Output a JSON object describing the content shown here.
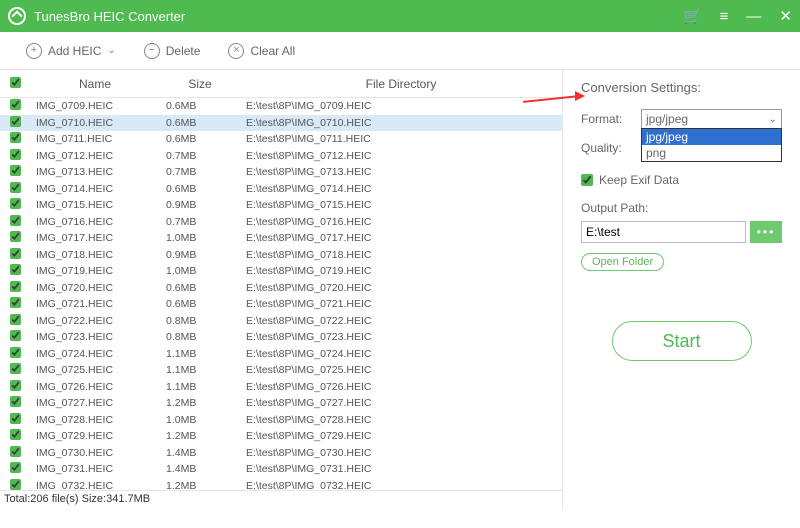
{
  "title": "TunesBro HEIC Converter",
  "toolbar": {
    "add": "Add HEIC",
    "delete": "Delete",
    "clear": "Clear All"
  },
  "columns": {
    "name": "Name",
    "size": "Size",
    "dir": "File Directory"
  },
  "files": [
    {
      "n": "IMG_0709.HEIC",
      "s": "0.6MB",
      "d": "E:\\test\\8P\\IMG_0709.HEIC",
      "sel": false
    },
    {
      "n": "IMG_0710.HEIC",
      "s": "0.6MB",
      "d": "E:\\test\\8P\\IMG_0710.HEIC",
      "sel": true
    },
    {
      "n": "IMG_0711.HEIC",
      "s": "0.6MB",
      "d": "E:\\test\\8P\\IMG_0711.HEIC",
      "sel": false
    },
    {
      "n": "IMG_0712.HEIC",
      "s": "0.7MB",
      "d": "E:\\test\\8P\\IMG_0712.HEIC",
      "sel": false
    },
    {
      "n": "IMG_0713.HEIC",
      "s": "0.7MB",
      "d": "E:\\test\\8P\\IMG_0713.HEIC",
      "sel": false
    },
    {
      "n": "IMG_0714.HEIC",
      "s": "0.6MB",
      "d": "E:\\test\\8P\\IMG_0714.HEIC",
      "sel": false
    },
    {
      "n": "IMG_0715.HEIC",
      "s": "0.9MB",
      "d": "E:\\test\\8P\\IMG_0715.HEIC",
      "sel": false
    },
    {
      "n": "IMG_0716.HEIC",
      "s": "0.7MB",
      "d": "E:\\test\\8P\\IMG_0716.HEIC",
      "sel": false
    },
    {
      "n": "IMG_0717.HEIC",
      "s": "1.0MB",
      "d": "E:\\test\\8P\\IMG_0717.HEIC",
      "sel": false
    },
    {
      "n": "IMG_0718.HEIC",
      "s": "0.9MB",
      "d": "E:\\test\\8P\\IMG_0718.HEIC",
      "sel": false
    },
    {
      "n": "IMG_0719.HEIC",
      "s": "1.0MB",
      "d": "E:\\test\\8P\\IMG_0719.HEIC",
      "sel": false
    },
    {
      "n": "IMG_0720.HEIC",
      "s": "0.6MB",
      "d": "E:\\test\\8P\\IMG_0720.HEIC",
      "sel": false
    },
    {
      "n": "IMG_0721.HEIC",
      "s": "0.6MB",
      "d": "E:\\test\\8P\\IMG_0721.HEIC",
      "sel": false
    },
    {
      "n": "IMG_0722.HEIC",
      "s": "0.8MB",
      "d": "E:\\test\\8P\\IMG_0722.HEIC",
      "sel": false
    },
    {
      "n": "IMG_0723.HEIC",
      "s": "0.8MB",
      "d": "E:\\test\\8P\\IMG_0723.HEIC",
      "sel": false
    },
    {
      "n": "IMG_0724.HEIC",
      "s": "1.1MB",
      "d": "E:\\test\\8P\\IMG_0724.HEIC",
      "sel": false
    },
    {
      "n": "IMG_0725.HEIC",
      "s": "1.1MB",
      "d": "E:\\test\\8P\\IMG_0725.HEIC",
      "sel": false
    },
    {
      "n": "IMG_0726.HEIC",
      "s": "1.1MB",
      "d": "E:\\test\\8P\\IMG_0726.HEIC",
      "sel": false
    },
    {
      "n": "IMG_0727.HEIC",
      "s": "1.2MB",
      "d": "E:\\test\\8P\\IMG_0727.HEIC",
      "sel": false
    },
    {
      "n": "IMG_0728.HEIC",
      "s": "1.0MB",
      "d": "E:\\test\\8P\\IMG_0728.HEIC",
      "sel": false
    },
    {
      "n": "IMG_0729.HEIC",
      "s": "1.2MB",
      "d": "E:\\test\\8P\\IMG_0729.HEIC",
      "sel": false
    },
    {
      "n": "IMG_0730.HEIC",
      "s": "1.4MB",
      "d": "E:\\test\\8P\\IMG_0730.HEIC",
      "sel": false
    },
    {
      "n": "IMG_0731.HEIC",
      "s": "1.4MB",
      "d": "E:\\test\\8P\\IMG_0731.HEIC",
      "sel": false
    },
    {
      "n": "IMG_0732.HEIC",
      "s": "1.2MB",
      "d": "E:\\test\\8P\\IMG_0732.HEIC",
      "sel": false
    }
  ],
  "status": "Total:206 file(s) Size:341.7MB",
  "settings": {
    "heading": "Conversion Settings:",
    "format_label": "Format:",
    "format_value": "jpg/jpeg",
    "format_options": [
      "jpg/jpeg",
      "png"
    ],
    "quality_label": "Quality:",
    "keep_exif": "Keep Exif Data",
    "output_label": "Output Path:",
    "output_value": "E:\\test",
    "open_folder": "Open Folder",
    "start": "Start"
  }
}
